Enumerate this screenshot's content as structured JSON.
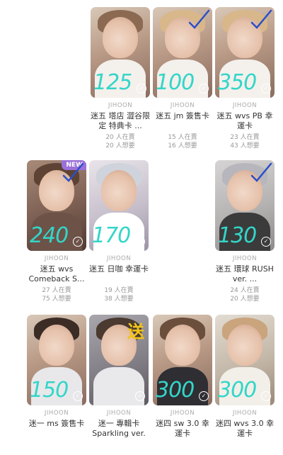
{
  "cards": [
    {
      "artist": "JIHOON",
      "title": "迷五 塔店 澀谷限定 特典卡 ...",
      "on_sale": "20 人在賣",
      "wanted": "20 人想要",
      "price": "125",
      "checked": false,
      "new": false,
      "sent": false
    },
    {
      "artist": "JIHOON",
      "title": "迷五 jm 簽售卡",
      "on_sale": "15 人在賣",
      "wanted": "16 人想要",
      "price": "100",
      "checked": true,
      "new": false,
      "sent": false
    },
    {
      "artist": "JIHOON",
      "title": "迷五 wvs PB 幸運卡",
      "on_sale": "23 人在賣",
      "wanted": "43 人想要",
      "price": "350",
      "checked": true,
      "new": false,
      "sent": false
    },
    {
      "artist": "JIHOON",
      "title": "迷五 wvs Comeback S...",
      "on_sale": "27 人在賣",
      "wanted": "75 人想要",
      "price": "240",
      "checked": true,
      "new": true,
      "sent": false
    },
    {
      "artist": "JIHOON",
      "title": "迷五 日咖 幸運卡",
      "on_sale": "19 人在賣",
      "wanted": "38 人想要",
      "price": "170",
      "checked": false,
      "new": false,
      "sent": false
    },
    {
      "artist": "JIHOON",
      "title": "迷五 環球 RUSH ver. ...",
      "on_sale": "24 人在賣",
      "wanted": "20 人想要",
      "price": "130",
      "checked": true,
      "new": false,
      "sent": false
    },
    {
      "artist": "JIHOON",
      "title": "迷一 ms 簽售卡",
      "on_sale": "",
      "wanted": "",
      "price": "150",
      "checked": false,
      "new": false,
      "sent": false
    },
    {
      "artist": "JIHOON",
      "title": "迷一 專輯卡 Sparkling ver.",
      "on_sale": "",
      "wanted": "",
      "price": "",
      "checked": false,
      "new": false,
      "sent": true,
      "sent_label": "送"
    },
    {
      "artist": "JIHOON",
      "title": "迷四 sw 3.0 幸運卡",
      "on_sale": "",
      "wanted": "",
      "price": "300",
      "checked": false,
      "new": false,
      "sent": false
    },
    {
      "artist": "JIHOON",
      "title": "迷四 wvs 3.0 幸運卡",
      "on_sale": "",
      "wanted": "",
      "price": "300",
      "checked": false,
      "new": false,
      "sent": false
    }
  ],
  "new_badge_label": "NEW",
  "colors": {
    "price_annotation": "#33d6c8",
    "check_mark": "#2b4fc9",
    "sent_annotation": "#f0c419",
    "new_badge": "#9b70d8"
  }
}
